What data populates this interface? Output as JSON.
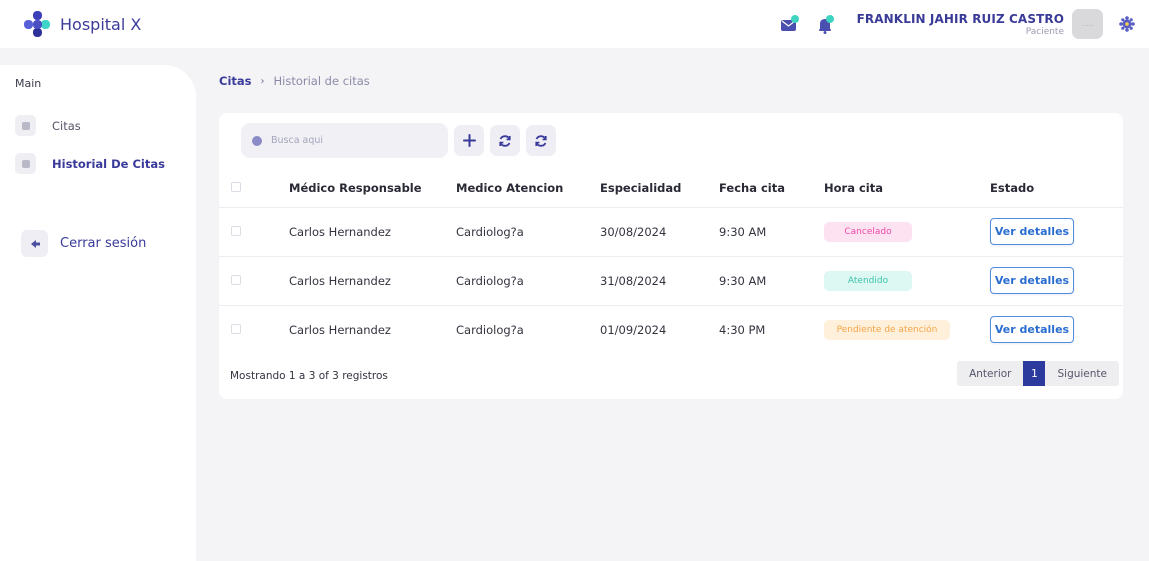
{
  "app": {
    "title": "Hospital X"
  },
  "header": {
    "user_name": "FRANKLIN JAHIR RUIZ CASTRO",
    "user_role": "Paciente",
    "avatar_text": "....."
  },
  "sidebar": {
    "section": "Main",
    "items": [
      {
        "label": "Citas",
        "active": false
      },
      {
        "label": "Historial De Citas",
        "active": true
      }
    ],
    "logout_label": "Cerrar sesión"
  },
  "breadcrumb": {
    "root": "Citas",
    "separator": "›",
    "current": "Historial de citas"
  },
  "search": {
    "placeholder": "Busca aqui"
  },
  "table": {
    "headers": [
      "Médico Responsable",
      "Medico Atencion",
      "Especialidad",
      "Fecha cita",
      "Hora cita",
      "Estado"
    ],
    "rows": [
      {
        "responsable": "Carlos Hernandez",
        "atencion": "Cardiolog?a",
        "especialidad": "30/08/2024",
        "fecha": "9:30 AM",
        "hora": "Cancelado",
        "estado": "Ver detalles"
      },
      {
        "responsable": "Carlos Hernandez",
        "atencion": "Cardiolog?a",
        "especialidad": "31/08/2024",
        "fecha": "9:30 AM",
        "hora": "Atendido",
        "estado": "Ver detalles"
      },
      {
        "responsable": "Carlos Hernandez",
        "atencion": "Cardiolog?a",
        "especialidad": "01/09/2024",
        "fecha": "4:30 PM",
        "hora": "Pendiente de atención",
        "estado": "Ver detalles"
      }
    ]
  },
  "footer": {
    "info": "Mostrando 1 a 3 of 3 registros"
  },
  "pagination": {
    "prev": "Anterior",
    "page": "1",
    "next": "Siguiente"
  },
  "colors": {
    "brand": "#3a3a9a",
    "cancelled": "#ea4aa8",
    "attended": "#3dc4ac",
    "pending": "#f4a546",
    "active_page": "#2b3a9c"
  }
}
